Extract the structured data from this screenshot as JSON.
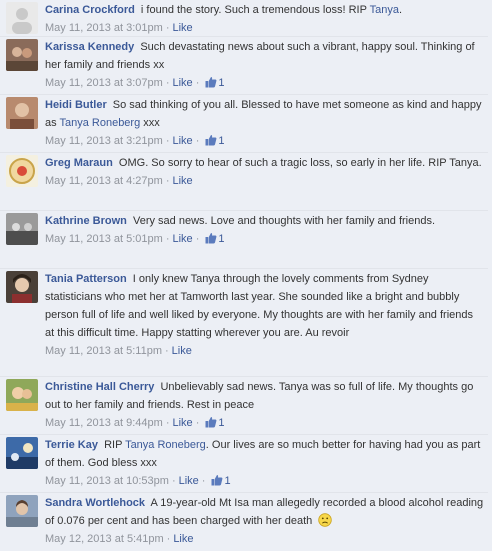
{
  "comments": [
    {
      "name": "Carina Crockford",
      "text_before": "i found the story. Such a tremendous loss! RIP",
      "mention": "Tanya",
      "text_after": ".",
      "timestamp": "May 11, 2013 at 3:01pm",
      "like_label": "Like",
      "likes": null,
      "avatar_color": "#e9e9e9"
    },
    {
      "name": "Karissa Kennedy",
      "text_before": "Such devastating news about such a vibrant, happy soul. Thinking of her family and friends xx",
      "mention": "",
      "text_after": "",
      "timestamp": "May 11, 2013 at 3:07pm",
      "like_label": "Like",
      "likes": "1",
      "avatar_color": "#8a6b5a"
    },
    {
      "name": "Heidi Butler",
      "text_before": "So sad thinking of you all. Blessed to have met someone as kind and happy as",
      "mention": "Tanya Roneberg",
      "text_after": "xxx",
      "timestamp": "May 11, 2013 at 3:21pm",
      "like_label": "Like",
      "likes": "1",
      "avatar_color": "#b88a6e"
    },
    {
      "name": "Greg Maraun",
      "text_before": "OMG. So sorry to hear of such a tragic loss, so early in her life. RIP Tanya.",
      "mention": "",
      "text_after": "",
      "timestamp": "May 11, 2013 at 4:27pm",
      "like_label": "Like",
      "likes": null,
      "avatar_color": "#f0d8a0"
    },
    {
      "name": "Kathrine Brown",
      "text_before": "Very sad news. Love and thoughts with her family and friends.",
      "mention": "",
      "text_after": "",
      "timestamp": "May 11, 2013 at 5:01pm",
      "like_label": "Like",
      "likes": "1",
      "avatar_color": "#6e6e6e"
    },
    {
      "name": "Tania Patterson",
      "text_before": "I only knew Tanya through the lovely comments from Sydney statisticians who met her at Tamworth last year. She sounded like a bright and bubbly person full of life and well liked by everyone. My thoughts are with her family and friends at this difficult time. Happy statting wherever you are. Au revoir",
      "mention": "",
      "text_after": "",
      "timestamp": "May 11, 2013 at 5:11pm",
      "like_label": "Like",
      "likes": null,
      "avatar_color": "#4a4038"
    },
    {
      "name": "Christine Hall Cherry",
      "text_before": "Unbelievably sad news. Tanya was so full of life. My thoughts go out to her family and friends. Rest in peace",
      "mention": "",
      "text_after": "",
      "timestamp": "May 11, 2013 at 9:44pm",
      "like_label": "Like",
      "likes": "1",
      "avatar_color": "#8fa85a"
    },
    {
      "name": "Terrie Kay",
      "text_before": "RIP",
      "mention": "Tanya Roneberg",
      "text_after": ". Our lives are so much better for having had you as part of them. God bless xxx",
      "timestamp": "May 11, 2013 at 10:53pm",
      "like_label": "Like",
      "likes": "1",
      "avatar_color": "#3d6aa8"
    },
    {
      "name": "Sandra Wortlehock",
      "text_before": "A 19-year-old Mt Isa man allegedly recorded a blood alcohol reading of 0.076 per cent and has been charged with her death",
      "mention": "",
      "text_after": "",
      "timestamp": "May 12, 2013 at 5:41pm",
      "like_label": "Like",
      "likes": null,
      "avatar_color": "#6f7f92",
      "emoji": "sad-face"
    }
  ]
}
